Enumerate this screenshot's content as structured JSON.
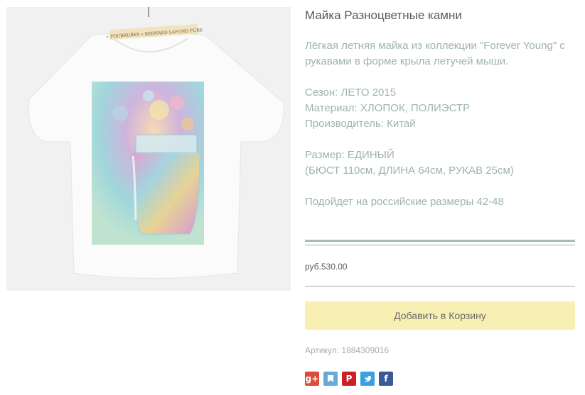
{
  "product": {
    "title": "Майка Разноцветные камни",
    "label_tag_text": "« FOURRURES » BERNARD LAFOND FURS",
    "description": {
      "intro": "Лёгкая летняя майка из коллекции \"Forever Young\" с рукавами в форме крыла летучей мыши.",
      "season": "Сезон: ЛЕТО 2015",
      "material": "Материал: ХЛОПОК, ПОЛИЭСТР",
      "manufacturer": "Производитель: Китай",
      "size": "Размер: ЕДИНЫЙ",
      "size_details": "(БЮСТ 110см, ДЛИНА 64см, РУКАВ 25см)",
      "russian_sizes": "Подойдет на российские размеры 42-48"
    },
    "price": "руб.530.00",
    "add_to_cart_label": "Добавить в Корзину",
    "sku": "Артикул: 1884309016"
  },
  "social": [
    {
      "name": "google-plus-icon",
      "glyph": "g+",
      "color": "#dd4b39"
    },
    {
      "name": "bookmark-icon",
      "glyph": "",
      "color": "#6aa8d8"
    },
    {
      "name": "pinterest-icon",
      "glyph": "P",
      "color": "#cb2027"
    },
    {
      "name": "twitter-icon",
      "glyph": "",
      "color": "#3aa1e0"
    },
    {
      "name": "facebook-icon",
      "glyph": "f",
      "color": "#3b5998"
    }
  ],
  "colors": {
    "button_bg": "#f8f0b3",
    "description_text": "#9fb3ac",
    "divider": "#a9bbb6"
  }
}
